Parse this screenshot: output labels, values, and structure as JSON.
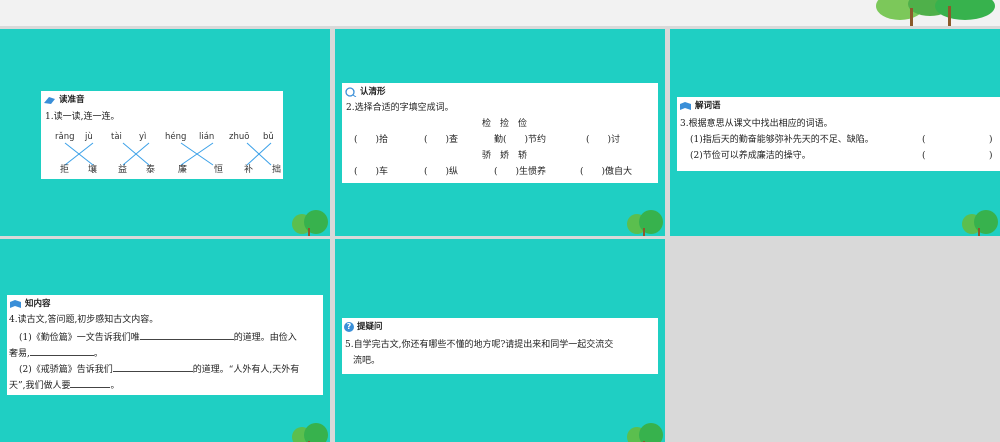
{
  "colors": {
    "slide_bg": "#1fcfc3",
    "frame_bg": "#d9d9d9",
    "card_bg": "#ffffff",
    "tree_green": "#37b24d"
  },
  "slide1": {
    "header": "读准音",
    "question": "1.读一读,连一连。",
    "pinyin": [
      "rǎng",
      "jù",
      "tài",
      "yì",
      "héng",
      "lián",
      "zhuō",
      "bǔ"
    ],
    "chars": [
      "拒",
      "壤",
      "益",
      "泰",
      "廉",
      "恒",
      "补",
      "拙"
    ]
  },
  "slide2": {
    "header": "认清形",
    "question": "2.选择合适的字填空成词。",
    "group1": "检　捡　俭",
    "row1": [
      "(　　)拾",
      "(　　)查",
      "勤(　　)节约",
      "(　　)讨"
    ],
    "group2": "骄　娇　轿",
    "row2": [
      "(　　)车",
      "(　　)纵",
      "(　　)生惯养",
      "(　　)傲自大"
    ]
  },
  "slide3": {
    "header": "解词语",
    "question": "3.根据意思从课文中找出相应的词语。",
    "item1": "(1)指后天的勤奋能够弥补先天的不足、缺陷。",
    "item2": "(2)节俭可以养成廉洁的操守。",
    "paren_open": "(",
    "paren_close": ")"
  },
  "slide4": {
    "header": "知内容",
    "question": "4.读古文,答问题,初步感知古文内容。",
    "l1a": "(1)《勤俭篇》一文告诉我们唯",
    "l1b": "的道理。由俭入",
    "l2a": "奢易,",
    "l2b": "。",
    "l3a": "(2)《戒骄篇》告诉我们",
    "l3b": "的道理。“人外有人,天外有",
    "l4a": "天”,我们做人要",
    "l4b": "。"
  },
  "slide5": {
    "header": "提疑问",
    "question": "5.自学完古文,你还有哪些不懂的地方呢?请提出来和同学一起交流交",
    "question_cont": "流吧。"
  }
}
